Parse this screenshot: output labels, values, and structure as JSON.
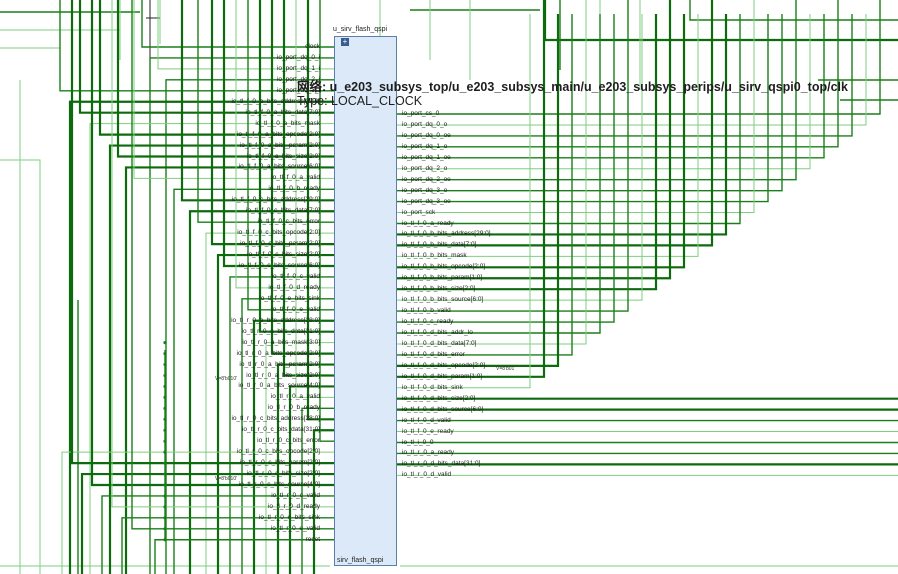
{
  "instance_name": "u_sirv_flash_qspi",
  "module_name": "sirv_flash_qspi",
  "expand_glyph": "+",
  "tooltip": {
    "net_label": "网络: u_e203_subsys_top/u_e203_subsys_main/u_e203_subsys_perips/u_sirv_qspi0_top/clk",
    "type_label": "Type: LOCAL_CLOCK"
  },
  "left_pins": [
    "clock",
    "io_port_dq_0_i",
    "io_port_dq_1_i",
    "io_port_dq_2_i",
    "io_port_dq_3_i",
    "io_tl_f_0_a_bits_address[29:0]",
    "io_tl_f_0_a_bits_data[7:0]",
    "io_tl_f_0_a_bits_mask",
    "io_tl_f_0_a_bits_opcode[2:0]",
    "io_tl_f_0_a_bits_param[2:0]",
    "io_tl_f_0_a_bits_size[2:0]",
    "io_tl_f_0_a_bits_source[6:0]",
    "io_tl_f_0_a_valid",
    "io_tl_f_0_b_ready",
    "io_tl_f_0_c_bits_address[29:0]",
    "io_tl_f_0_c_bits_data[7:0]",
    "io_tl_f_0_c_bits_error",
    "io_tl_f_0_c_bits_opcode[2:0]",
    "io_tl_f_0_c_bits_param[2:0]",
    "io_tl_f_0_c_bits_size[2:0]",
    "io_tl_f_0_c_bits_source[6:0]",
    "io_tl_f_0_c_valid",
    "io_tl_f_0_d_ready",
    "io_tl_f_0_e_bits_sink",
    "io_tl_f_0_e_valid",
    "io_tl_r_0_a_bits_address[28:0]",
    "io_tl_r_0_a_bits_data[31:0]",
    "io_tl_r_0_a_bits_mask[3:0]",
    "io_tl_r_0_a_bits_opcode[2:0]",
    "io_tl_r_0_a_bits_param[2:0]",
    "io_tl_r_0_a_bits_size[2:0]",
    "io_tl_r_0_a_bits_source[4:0]",
    "io_tl_r_0_a_valid",
    "io_tl_r_0_b_ready",
    "io_tl_r_0_c_bits_address[28:0]",
    "io_tl_r_0_c_bits_data[31:0]",
    "io_tl_r_0_c_bits_error",
    "io_tl_r_0_c_bits_opcode[2:0]",
    "io_tl_r_0_c_bits_param[2:0]",
    "io_tl_r_0_c_bits_size[2:0]",
    "io_tl_r_0_c_bits_source[4:0]",
    "io_tl_r_0_c_valid",
    "io_tl_r_0_d_ready",
    "io_tl_r_0_e_bits_sink",
    "io_tl_r_0_e_valid",
    "reset"
  ],
  "right_pins": [
    "io_port_cs_0",
    "io_port_dq_0_o",
    "io_port_dq_0_oe",
    "io_port_dq_1_o",
    "io_port_dq_1_oe",
    "io_port_dq_2_o",
    "io_port_dq_2_oe",
    "io_port_dq_3_o",
    "io_port_dq_3_oe",
    "io_port_sck",
    "io_tl_f_0_a_ready",
    "io_tl_f_0_b_bits_address[29:0]",
    "io_tl_f_0_b_bits_data[7:0]",
    "io_tl_f_0_b_bits_mask",
    "io_tl_f_0_b_bits_opcode[2:0]",
    "io_tl_f_0_b_bits_param[1:0]",
    "io_tl_f_0_b_bits_size[2:0]",
    "io_tl_f_0_b_bits_source[6:0]",
    "io_tl_f_0_b_valid",
    "io_tl_f_0_c_ready",
    "io_tl_f_0_d_bits_addr_lo",
    "io_tl_f_0_d_bits_data[7:0]",
    "io_tl_f_0_d_bits_error",
    "io_tl_f_0_d_bits_opcode[2:0]",
    "io_tl_f_0_d_bits_param[1:0]",
    "io_tl_f_0_d_bits_sink",
    "io_tl_f_0_d_bits_size[2:0]",
    "io_tl_f_0_d_bits_source[6:0]",
    "io_tl_f_0_d_valid",
    "io_tl_f_0_e_ready",
    "io_tl_i_0_0",
    "io_tl_r_0_a_ready",
    "io_tl_r_0_d_bits_data[31:0]",
    "io_tl_r_0_d_valid"
  ],
  "value_labels": {
    "left_a": "V=8'b010'",
    "left_c": "V=8'b010'",
    "right_d": "V=8'b01'"
  },
  "colors": {
    "wire": "#1a7f1a",
    "wire_light": "#7fcf7f",
    "block_fill": "#dbe9f8",
    "block_border": "#5b7fa8"
  }
}
